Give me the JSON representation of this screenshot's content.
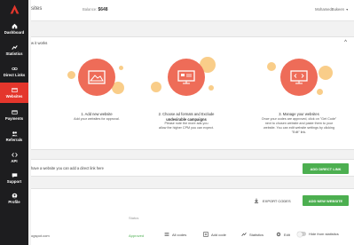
{
  "sidebar": {
    "items": [
      {
        "label": "Dashboard",
        "icon": "home-icon"
      },
      {
        "label": "Statistics",
        "icon": "statistics-icon"
      },
      {
        "label": "Direct Links",
        "icon": "link-icon"
      },
      {
        "label": "Websites",
        "icon": "websites-icon",
        "active": true
      },
      {
        "label": "Payments",
        "icon": "payments-icon"
      },
      {
        "label": "Referrals",
        "icon": "referrals-icon"
      },
      {
        "label": "API",
        "icon": "api-icon"
      },
      {
        "label": "Support",
        "icon": "support-icon"
      },
      {
        "label": "Profile",
        "icon": "profile-icon"
      }
    ],
    "active_color": "#e4362c"
  },
  "header": {
    "title": "sites",
    "balance_label": "Balance:",
    "balance_value": "$648",
    "user": "MohamedBukeen"
  },
  "how_it_works": {
    "title": "w it works",
    "steps": [
      {
        "title": "1. Add new website",
        "desc": [
          "Add your websites for approval."
        ]
      },
      {
        "title": "2. Choose ad formats and Exclude",
        "title2": "undesirable campaigns",
        "desc": [
          "Please note the more ads you",
          "allow the higher CPM you can expect."
        ]
      },
      {
        "title": "3. Manage your websites",
        "desc": [
          "Once your codes are approved, click on \"Get Code\"",
          "next to chosen website and paste them to your",
          "website. You can edit website settings by clicking",
          "\"Edit\" link."
        ]
      }
    ]
  },
  "direct_link_bar": {
    "text": "have a website you can add a direct link here",
    "button": "ADD DIRECT LINK"
  },
  "websites": {
    "export_label": "EXPORT CODES",
    "add_button": "ADD NEW WEBSITE",
    "status_header": "Status",
    "row": {
      "site": "ogspot.com",
      "status": "Approved",
      "all_codes": "All codes",
      "add_code": "Add code",
      "statistics": "Statistics",
      "edit": "Edit",
      "hide": "Hide from statistics"
    }
  },
  "colors": {
    "accent": "#e4362c",
    "green": "#4caf50",
    "illustration": "#ee6c58",
    "blob": "#f7c16b"
  }
}
